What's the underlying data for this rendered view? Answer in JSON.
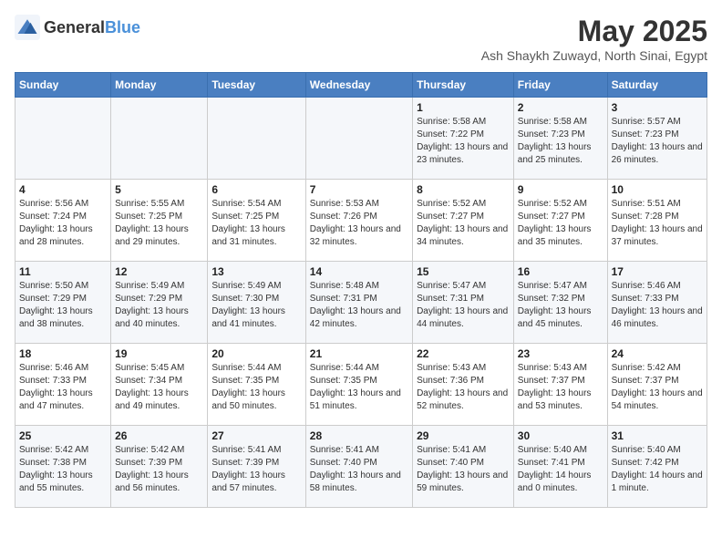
{
  "header": {
    "logo_general": "General",
    "logo_blue": "Blue",
    "title": "May 2025",
    "subtitle": "Ash Shaykh Zuwayd, North Sinai, Egypt"
  },
  "weekdays": [
    "Sunday",
    "Monday",
    "Tuesday",
    "Wednesday",
    "Thursday",
    "Friday",
    "Saturday"
  ],
  "weeks": [
    [
      {
        "num": "",
        "sunrise": "",
        "sunset": "",
        "daylight": ""
      },
      {
        "num": "",
        "sunrise": "",
        "sunset": "",
        "daylight": ""
      },
      {
        "num": "",
        "sunrise": "",
        "sunset": "",
        "daylight": ""
      },
      {
        "num": "",
        "sunrise": "",
        "sunset": "",
        "daylight": ""
      },
      {
        "num": "1",
        "sunrise": "Sunrise: 5:58 AM",
        "sunset": "Sunset: 7:22 PM",
        "daylight": "Daylight: 13 hours and 23 minutes."
      },
      {
        "num": "2",
        "sunrise": "Sunrise: 5:58 AM",
        "sunset": "Sunset: 7:23 PM",
        "daylight": "Daylight: 13 hours and 25 minutes."
      },
      {
        "num": "3",
        "sunrise": "Sunrise: 5:57 AM",
        "sunset": "Sunset: 7:23 PM",
        "daylight": "Daylight: 13 hours and 26 minutes."
      }
    ],
    [
      {
        "num": "4",
        "sunrise": "Sunrise: 5:56 AM",
        "sunset": "Sunset: 7:24 PM",
        "daylight": "Daylight: 13 hours and 28 minutes."
      },
      {
        "num": "5",
        "sunrise": "Sunrise: 5:55 AM",
        "sunset": "Sunset: 7:25 PM",
        "daylight": "Daylight: 13 hours and 29 minutes."
      },
      {
        "num": "6",
        "sunrise": "Sunrise: 5:54 AM",
        "sunset": "Sunset: 7:25 PM",
        "daylight": "Daylight: 13 hours and 31 minutes."
      },
      {
        "num": "7",
        "sunrise": "Sunrise: 5:53 AM",
        "sunset": "Sunset: 7:26 PM",
        "daylight": "Daylight: 13 hours and 32 minutes."
      },
      {
        "num": "8",
        "sunrise": "Sunrise: 5:52 AM",
        "sunset": "Sunset: 7:27 PM",
        "daylight": "Daylight: 13 hours and 34 minutes."
      },
      {
        "num": "9",
        "sunrise": "Sunrise: 5:52 AM",
        "sunset": "Sunset: 7:27 PM",
        "daylight": "Daylight: 13 hours and 35 minutes."
      },
      {
        "num": "10",
        "sunrise": "Sunrise: 5:51 AM",
        "sunset": "Sunset: 7:28 PM",
        "daylight": "Daylight: 13 hours and 37 minutes."
      }
    ],
    [
      {
        "num": "11",
        "sunrise": "Sunrise: 5:50 AM",
        "sunset": "Sunset: 7:29 PM",
        "daylight": "Daylight: 13 hours and 38 minutes."
      },
      {
        "num": "12",
        "sunrise": "Sunrise: 5:49 AM",
        "sunset": "Sunset: 7:29 PM",
        "daylight": "Daylight: 13 hours and 40 minutes."
      },
      {
        "num": "13",
        "sunrise": "Sunrise: 5:49 AM",
        "sunset": "Sunset: 7:30 PM",
        "daylight": "Daylight: 13 hours and 41 minutes."
      },
      {
        "num": "14",
        "sunrise": "Sunrise: 5:48 AM",
        "sunset": "Sunset: 7:31 PM",
        "daylight": "Daylight: 13 hours and 42 minutes."
      },
      {
        "num": "15",
        "sunrise": "Sunrise: 5:47 AM",
        "sunset": "Sunset: 7:31 PM",
        "daylight": "Daylight: 13 hours and 44 minutes."
      },
      {
        "num": "16",
        "sunrise": "Sunrise: 5:47 AM",
        "sunset": "Sunset: 7:32 PM",
        "daylight": "Daylight: 13 hours and 45 minutes."
      },
      {
        "num": "17",
        "sunrise": "Sunrise: 5:46 AM",
        "sunset": "Sunset: 7:33 PM",
        "daylight": "Daylight: 13 hours and 46 minutes."
      }
    ],
    [
      {
        "num": "18",
        "sunrise": "Sunrise: 5:46 AM",
        "sunset": "Sunset: 7:33 PM",
        "daylight": "Daylight: 13 hours and 47 minutes."
      },
      {
        "num": "19",
        "sunrise": "Sunrise: 5:45 AM",
        "sunset": "Sunset: 7:34 PM",
        "daylight": "Daylight: 13 hours and 49 minutes."
      },
      {
        "num": "20",
        "sunrise": "Sunrise: 5:44 AM",
        "sunset": "Sunset: 7:35 PM",
        "daylight": "Daylight: 13 hours and 50 minutes."
      },
      {
        "num": "21",
        "sunrise": "Sunrise: 5:44 AM",
        "sunset": "Sunset: 7:35 PM",
        "daylight": "Daylight: 13 hours and 51 minutes."
      },
      {
        "num": "22",
        "sunrise": "Sunrise: 5:43 AM",
        "sunset": "Sunset: 7:36 PM",
        "daylight": "Daylight: 13 hours and 52 minutes."
      },
      {
        "num": "23",
        "sunrise": "Sunrise: 5:43 AM",
        "sunset": "Sunset: 7:37 PM",
        "daylight": "Daylight: 13 hours and 53 minutes."
      },
      {
        "num": "24",
        "sunrise": "Sunrise: 5:42 AM",
        "sunset": "Sunset: 7:37 PM",
        "daylight": "Daylight: 13 hours and 54 minutes."
      }
    ],
    [
      {
        "num": "25",
        "sunrise": "Sunrise: 5:42 AM",
        "sunset": "Sunset: 7:38 PM",
        "daylight": "Daylight: 13 hours and 55 minutes."
      },
      {
        "num": "26",
        "sunrise": "Sunrise: 5:42 AM",
        "sunset": "Sunset: 7:39 PM",
        "daylight": "Daylight: 13 hours and 56 minutes."
      },
      {
        "num": "27",
        "sunrise": "Sunrise: 5:41 AM",
        "sunset": "Sunset: 7:39 PM",
        "daylight": "Daylight: 13 hours and 57 minutes."
      },
      {
        "num": "28",
        "sunrise": "Sunrise: 5:41 AM",
        "sunset": "Sunset: 7:40 PM",
        "daylight": "Daylight: 13 hours and 58 minutes."
      },
      {
        "num": "29",
        "sunrise": "Sunrise: 5:41 AM",
        "sunset": "Sunset: 7:40 PM",
        "daylight": "Daylight: 13 hours and 59 minutes."
      },
      {
        "num": "30",
        "sunrise": "Sunrise: 5:40 AM",
        "sunset": "Sunset: 7:41 PM",
        "daylight": "Daylight: 14 hours and 0 minutes."
      },
      {
        "num": "31",
        "sunrise": "Sunrise: 5:40 AM",
        "sunset": "Sunset: 7:42 PM",
        "daylight": "Daylight: 14 hours and 1 minute."
      }
    ]
  ]
}
